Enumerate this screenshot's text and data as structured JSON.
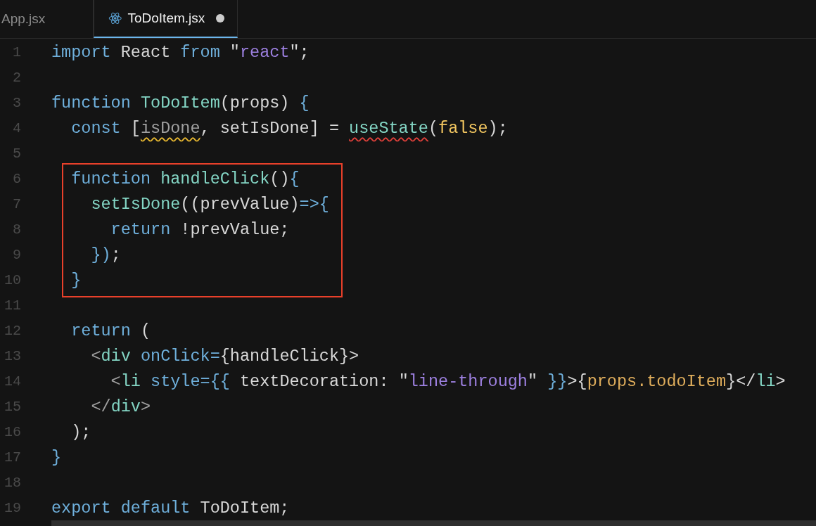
{
  "tabs": [
    {
      "label": "App.jsx",
      "selected": false,
      "modified": false
    },
    {
      "label": "ToDoItem.jsx",
      "selected": true,
      "modified": true
    }
  ],
  "lines": [
    {
      "number": "1",
      "boxed": false,
      "tokens": [
        {
          "text": "import",
          "kind": "kw"
        },
        {
          "text": " React ",
          "kind": "plain"
        },
        {
          "text": "from",
          "kind": "kw"
        },
        {
          "text": " \"",
          "kind": "plain"
        },
        {
          "text": "react",
          "kind": "str"
        },
        {
          "text": "\";",
          "kind": "plain"
        }
      ]
    },
    {
      "number": "2",
      "boxed": false
    },
    {
      "number": "3",
      "boxed": false,
      "tokens": [
        {
          "text": "function ",
          "kind": "kw"
        },
        {
          "text": "ToDoItem",
          "kind": "fn"
        },
        {
          "text": "(props) ",
          "kind": "plain"
        },
        {
          "text": "{",
          "kind": "kw"
        }
      ]
    },
    {
      "number": "4",
      "boxed": false,
      "tokens": [
        {
          "text": "  const",
          "kind": "kw"
        },
        {
          "text": " [",
          "kind": "plain"
        },
        {
          "text": "isDone",
          "kind": "dim",
          "warning": true
        },
        {
          "text": ", setIsDone] = ",
          "kind": "plain"
        },
        {
          "text": "useState",
          "kind": "fn",
          "error": true
        },
        {
          "text": "(",
          "kind": "plain"
        },
        {
          "text": "false",
          "kind": "bool"
        },
        {
          "text": ");",
          "kind": "plain"
        }
      ]
    },
    {
      "number": "5",
      "boxed": false
    },
    {
      "number": "6",
      "boxed": true,
      "tokens": [
        {
          "text": "  function ",
          "kind": "kw"
        },
        {
          "text": "handleClick",
          "kind": "fn"
        },
        {
          "text": "()",
          "kind": "plain"
        },
        {
          "text": "{",
          "kind": "kw"
        }
      ]
    },
    {
      "number": "7",
      "boxed": true,
      "tokens": [
        {
          "text": "    setIsDone",
          "kind": "fn"
        },
        {
          "text": "((prevValue)",
          "kind": "plain"
        },
        {
          "text": "=>{",
          "kind": "kw"
        }
      ]
    },
    {
      "number": "8",
      "boxed": true,
      "tokens": [
        {
          "text": "      return",
          "kind": "kw"
        },
        {
          "text": " !prevValue;",
          "kind": "plain"
        }
      ]
    },
    {
      "number": "9",
      "boxed": true,
      "tokens": [
        {
          "text": "    })",
          "kind": "kw"
        },
        {
          "text": ";",
          "kind": "plain"
        }
      ]
    },
    {
      "number": "10",
      "boxed": true,
      "tokens": [
        {
          "text": "  }",
          "kind": "kw"
        }
      ]
    },
    {
      "number": "11",
      "boxed": false
    },
    {
      "number": "12",
      "boxed": false,
      "tokens": [
        {
          "text": "  return",
          "kind": "kw"
        },
        {
          "text": " (",
          "kind": "plain"
        }
      ]
    },
    {
      "number": "13",
      "boxed": false,
      "tokens": [
        {
          "text": "    <",
          "kind": "dim"
        },
        {
          "text": "div",
          "kind": "tag"
        },
        {
          "text": " onClick",
          "kind": "attr"
        },
        {
          "text": "=",
          "kind": "kw"
        },
        {
          "text": "{handleClick}>",
          "kind": "plain"
        }
      ]
    },
    {
      "number": "14",
      "boxed": false,
      "tokens": [
        {
          "text": "      <",
          "kind": "dim"
        },
        {
          "text": "li",
          "kind": "tag"
        },
        {
          "text": " style",
          "kind": "attr"
        },
        {
          "text": "=",
          "kind": "kw"
        },
        {
          "text": "{{",
          "kind": "kw"
        },
        {
          "text": " textDecoration: \"",
          "kind": "plain"
        },
        {
          "text": "line-through",
          "kind": "str"
        },
        {
          "text": "\" ",
          "kind": "plain"
        },
        {
          "text": "}}",
          "kind": "kw"
        },
        {
          "text": ">{",
          "kind": "plain"
        },
        {
          "text": "props.todoItem",
          "kind": "prop"
        },
        {
          "text": "}</",
          "kind": "plain"
        },
        {
          "text": "li",
          "kind": "tag"
        },
        {
          "text": ">",
          "kind": "plain"
        }
      ]
    },
    {
      "number": "15",
      "boxed": false,
      "tokens": [
        {
          "text": "    </",
          "kind": "dim"
        },
        {
          "text": "div",
          "kind": "tag"
        },
        {
          "text": ">",
          "kind": "dim"
        }
      ]
    },
    {
      "number": "16",
      "boxed": false,
      "tokens": [
        {
          "text": "  );",
          "kind": "plain"
        }
      ]
    },
    {
      "number": "17",
      "boxed": false,
      "tokens": [
        {
          "text": "}",
          "kind": "kw"
        }
      ]
    },
    {
      "number": "18",
      "boxed": false
    },
    {
      "number": "19",
      "boxed": false,
      "tokens": [
        {
          "text": "export default",
          "kind": "kw"
        },
        {
          "text": " ToDoItem;",
          "kind": "plain"
        }
      ]
    }
  ]
}
